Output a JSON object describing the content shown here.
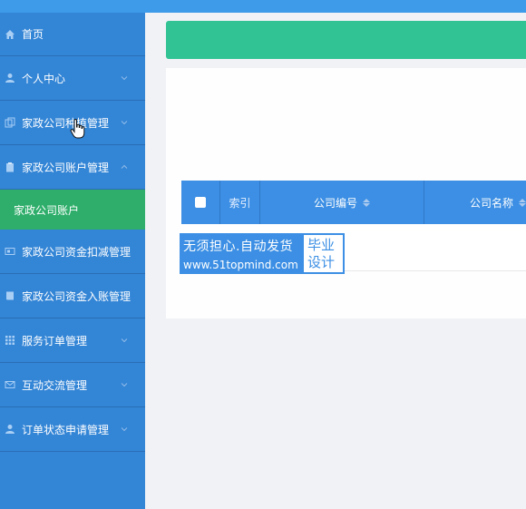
{
  "sidebar": {
    "items": [
      {
        "label": "首页",
        "icon": "home-icon",
        "has_chevron": false
      },
      {
        "label": "个人中心",
        "icon": "user-icon",
        "has_chevron": true
      },
      {
        "label": "家政公司种植管理",
        "icon": "copy-icon",
        "has_chevron": true
      },
      {
        "label": "家政公司账户管理",
        "icon": "clipboard-icon",
        "has_chevron": true,
        "expanded": true
      },
      {
        "label": "家政公司资金扣减管理",
        "icon": "wallet-icon",
        "has_chevron": true
      },
      {
        "label": "家政公司资金入账管理",
        "icon": "book-icon",
        "has_chevron": true
      },
      {
        "label": "服务订单管理",
        "icon": "grid-icon",
        "has_chevron": true
      },
      {
        "label": "互动交流管理",
        "icon": "mail-icon",
        "has_chevron": true
      },
      {
        "label": "订单状态申请管理",
        "icon": "user-icon",
        "has_chevron": true
      }
    ],
    "submenu_active": "家政公司账户"
  },
  "table": {
    "headers": {
      "index": "索引",
      "code": "公司编号",
      "name": "公司名称"
    }
  },
  "watermark": {
    "line1": "无须担心.自动发货",
    "line2": "www.51topmind.com",
    "right": "毕业设计"
  },
  "colors": {
    "sidebar": "#3385d6",
    "active": "#2eae6a",
    "header_bar": "#31c393",
    "table_head": "#3c8fe4"
  }
}
